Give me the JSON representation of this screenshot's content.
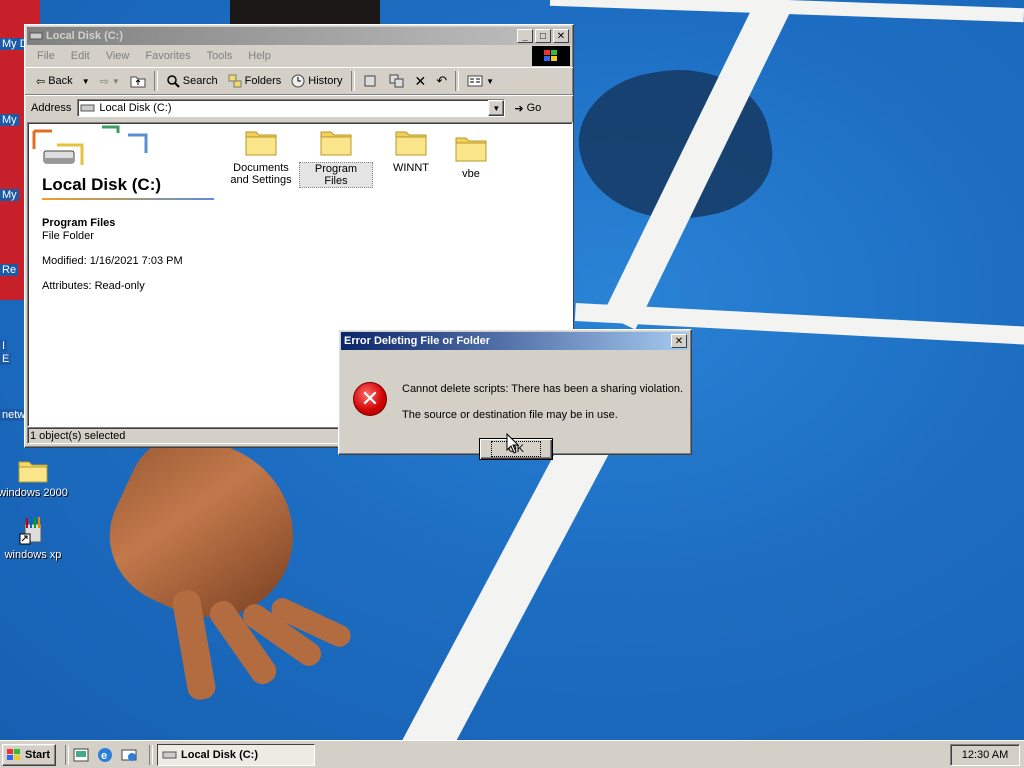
{
  "desktop": {
    "edge_labels": [
      "My D",
      "My",
      "My",
      "Re",
      "I",
      "E",
      "netw"
    ],
    "icons": [
      {
        "label": "windows 2000",
        "icon": "folder-icon"
      },
      {
        "label": "windows xp",
        "icon": "paint-shortcut-icon"
      }
    ]
  },
  "explorer": {
    "title": "Local Disk (C:)",
    "menu": [
      "File",
      "Edit",
      "View",
      "Favorites",
      "Tools",
      "Help"
    ],
    "toolbar": {
      "back": "Back",
      "search": "Search",
      "folders": "Folders",
      "history": "History"
    },
    "address": {
      "label": "Address",
      "value": "Local Disk (C:)",
      "go": "Go"
    },
    "webview": {
      "drive_title": "Local Disk (C:)",
      "selected_name": "Program Files",
      "selected_type": "File Folder",
      "modified": "Modified: 1/16/2021 7:03 PM",
      "attributes": "Attributes: Read-only"
    },
    "folders": [
      {
        "label": "Documents and Settings",
        "selected": false
      },
      {
        "label": "Program Files",
        "selected": true
      },
      {
        "label": "WINNT",
        "selected": false
      },
      {
        "label": "vbe",
        "selected": false
      }
    ],
    "status": "1 object(s) selected"
  },
  "dialog": {
    "title": "Error Deleting File or Folder",
    "message1": "Cannot delete scripts: There has been a sharing violation.",
    "message2": "The source or destination file may be in use.",
    "ok": "OK"
  },
  "taskbar": {
    "start": "Start",
    "task": "Local Disk (C:)",
    "clock": "12:30 AM"
  },
  "colors": {
    "active_title": "#0a246a",
    "inactive_title": "#808080",
    "face": "#d4d0c8"
  }
}
